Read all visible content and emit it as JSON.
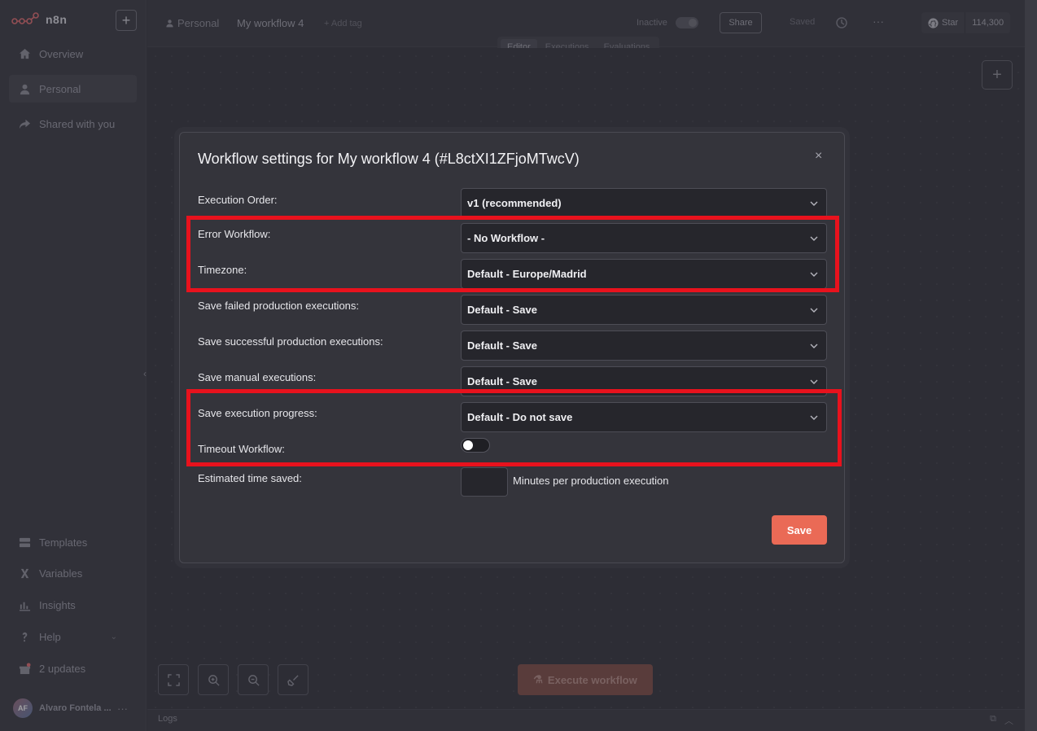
{
  "app": {
    "brand": "n8n"
  },
  "sidebar": {
    "items": [
      {
        "label": "Overview",
        "icon": "home-icon"
      },
      {
        "label": "Personal",
        "icon": "user-icon"
      },
      {
        "label": "Shared with you",
        "icon": "share-icon"
      }
    ],
    "bottom": [
      {
        "label": "Templates",
        "icon": "templates-icon"
      },
      {
        "label": "Variables",
        "icon": "variables-icon"
      },
      {
        "label": "Insights",
        "icon": "insights-icon"
      },
      {
        "label": "Help",
        "icon": "help-icon"
      },
      {
        "label": "2 updates",
        "icon": "gift-icon"
      }
    ],
    "user": {
      "initials": "AF",
      "name": "Alvaro Fontela ...",
      "more": "···"
    }
  },
  "header": {
    "breadcrumb_project": "Personal",
    "workflow_name": "My workflow 4",
    "add_tag": "+ Add tag",
    "status": "Inactive",
    "share_label": "Share",
    "saved_label": "Saved",
    "more": "···",
    "github": {
      "star_label": "Star",
      "count": "114,300"
    },
    "tabs": [
      {
        "label": "Editor"
      },
      {
        "label": "Executions"
      },
      {
        "label": "Evaluations"
      }
    ]
  },
  "canvas": {
    "execute_label": "Execute workflow",
    "logs_label": "Logs"
  },
  "modal": {
    "title": "Workflow settings for My workflow 4 (#L8ctXI1ZFjoMTwcV)",
    "close": "×",
    "rows": [
      {
        "label": "Execution Order:",
        "value": "v1 (recommended)"
      },
      {
        "label": "Error Workflow:",
        "value": "- No Workflow -"
      },
      {
        "label": "Timezone:",
        "value": "Default - Europe/Madrid"
      },
      {
        "label": "Save failed production executions:",
        "value": "Default - Save"
      },
      {
        "label": "Save successful production executions:",
        "value": "Default - Save"
      },
      {
        "label": "Save manual executions:",
        "value": "Default - Save"
      },
      {
        "label": "Save execution progress:",
        "value": "Default - Do not save"
      }
    ],
    "timeout": {
      "label": "Timeout Workflow:",
      "enabled": false
    },
    "estimated": {
      "label": "Estimated time saved:",
      "value": "",
      "suffix": "Minutes per production execution"
    },
    "save_label": "Save"
  },
  "colors": {
    "accent": "#ea6a56",
    "highlight": "#e8121d"
  }
}
